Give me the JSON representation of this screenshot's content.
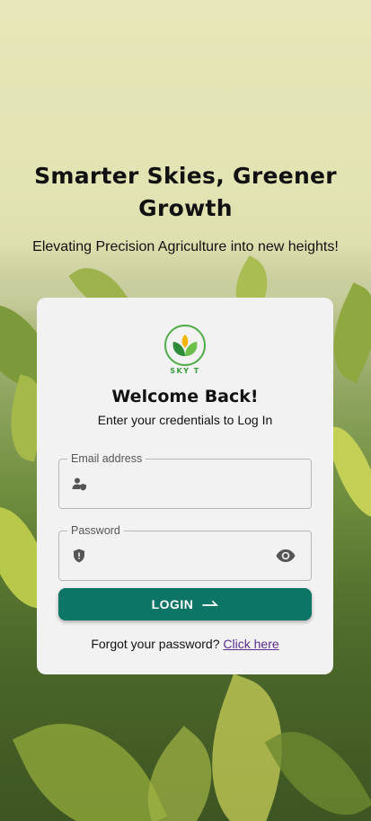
{
  "hero": {
    "title": "Smarter Skies, Greener Growth",
    "subtitle": "Elevating Precision Agriculture into new heights!"
  },
  "card": {
    "logo_text": "SKY T",
    "heading": "Welcome Back!",
    "instructions": "Enter your credentials to Log In",
    "email": {
      "label": "Email address",
      "value": "",
      "icon": "user-shield-icon"
    },
    "password": {
      "label": "Password",
      "value": "",
      "icon": "shield-icon",
      "toggle_icon": "eye-icon"
    },
    "login_label": "LOGIN",
    "login_icon": "arrow-right-icon",
    "forgot_text": "Forgot your password?",
    "forgot_link": "Click here"
  },
  "colors": {
    "primary": "#0c7566",
    "card_bg": "#f2f2f2",
    "link": "#5b2d8f",
    "logo_green": "#3a9b3e"
  }
}
